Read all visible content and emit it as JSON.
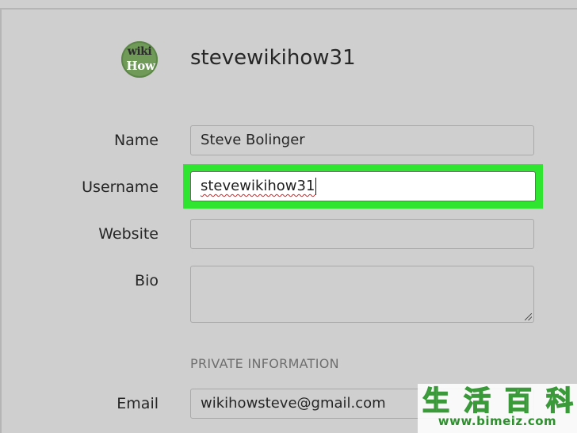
{
  "profile": {
    "avatar_logo_top": "wiki",
    "avatar_logo_bottom": "How",
    "username_heading": "stevewikihow31"
  },
  "form": {
    "name": {
      "label": "Name",
      "value": "Steve Bolinger"
    },
    "username": {
      "label": "Username",
      "value": "stevewikihow31"
    },
    "website": {
      "label": "Website",
      "value": ""
    },
    "bio": {
      "label": "Bio",
      "value": ""
    },
    "private_section_header": "PRIVATE INFORMATION",
    "email": {
      "label": "Email",
      "value": "wikihowsteve@gmail.com"
    }
  },
  "highlight_color": "#2fe52f",
  "watermark": {
    "chars": [
      "生",
      "活",
      "百",
      "科"
    ],
    "url": "www.bimeiz.com"
  }
}
